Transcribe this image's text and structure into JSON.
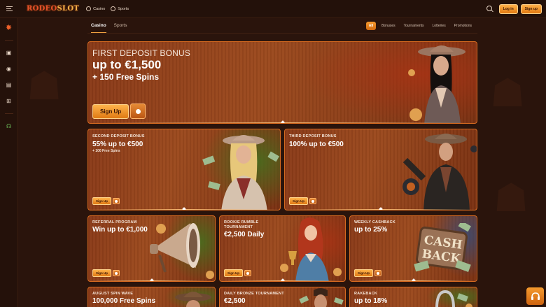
{
  "header": {
    "logo": {
      "brand": "RODEO",
      "suffix": "SLOT"
    },
    "nav": [
      {
        "label": "Casino",
        "icon": "casino-icon"
      },
      {
        "label": "Sports",
        "icon": "sports-icon"
      }
    ],
    "login_label": "Log in",
    "signup_label": "Sign up"
  },
  "sidebar": {
    "icons": [
      "sheriff-star-icon",
      "slot-machine-icon",
      "live-broadcast-icon",
      "live-casino-icon",
      "gamepad-icon",
      "support-headset-icon"
    ]
  },
  "subnav": {
    "tabs": [
      "Casino",
      "Sports"
    ],
    "active_tab": "Casino",
    "filters": [
      "All",
      "Bonuses",
      "Tournaments",
      "Lotteries",
      "Promotions"
    ],
    "active_filter": "All"
  },
  "cards": {
    "hero": {
      "caption": "FIRST DEPOSIT BONUS",
      "amount": "up to €1,500",
      "sub": "+ 150 Free Spins",
      "button": "Sign Up"
    },
    "second": {
      "caption": "SECOND DEPOSIT BONUS",
      "amount": "55% up to €500",
      "sub": "+ 100 Free Spins",
      "button": "Sign Up"
    },
    "third": {
      "caption": "THIRD DEPOSIT BONUS",
      "amount": "100% up to €500",
      "button": "Sign Up"
    },
    "referral": {
      "caption": "REFERRAL PROGRAM",
      "amount": "Win up to €1,000",
      "button": "Sign Up"
    },
    "rookie": {
      "caption_line1": "ROOKIE RUMBLE",
      "caption_line2": "TOURNAMENT",
      "amount": "€2,500 Daily",
      "button": "Sign Up"
    },
    "cashback": {
      "caption": "WEEKLY CASHBACK",
      "amount": "up to 25%",
      "button": "Sign Up",
      "sign_line1": "CASH",
      "sign_line2": "BACK"
    },
    "august": {
      "caption": "AUGUST SPIN WAVE",
      "amount": "100,000 Free Spins"
    },
    "bronze": {
      "caption": "DAILY BRONZE TOURNAMENT",
      "amount": "€2,500"
    },
    "rakeback": {
      "caption": "RAKEBACK",
      "amount": "up to 18%"
    }
  },
  "colors": {
    "accent": "#f59a2e",
    "background": "#2a140c",
    "card_border": "#d66a20"
  }
}
